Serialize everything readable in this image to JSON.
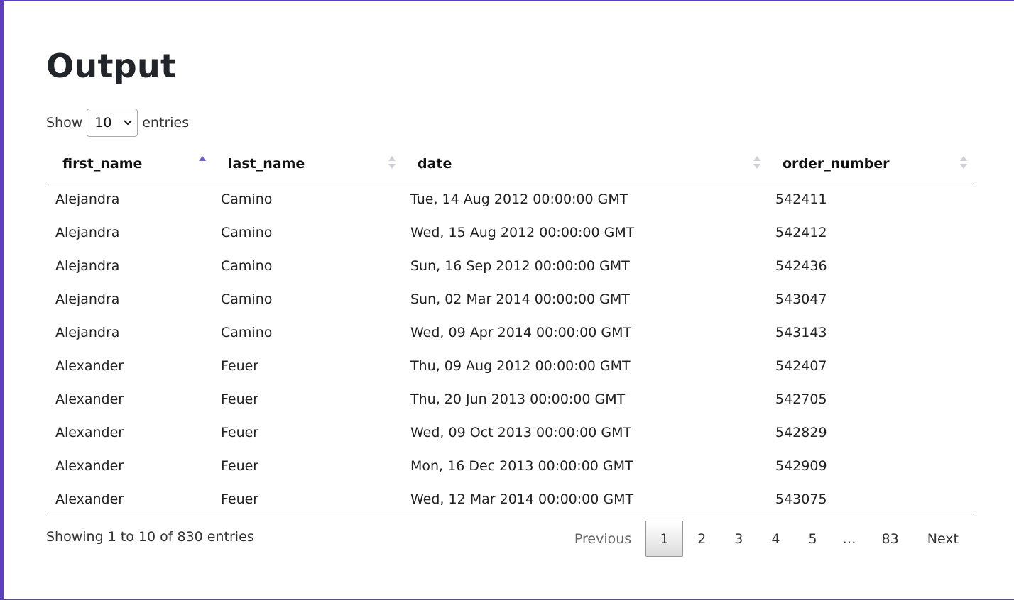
{
  "page": {
    "title": "Output"
  },
  "length": {
    "show_label": "Show",
    "selected": "10",
    "entries_label": "entries"
  },
  "table": {
    "columns": [
      "first_name",
      "last_name",
      "date",
      "order_number"
    ],
    "sorted_column": "first_name",
    "sort_direction": "ascending",
    "rows": [
      [
        "Alejandra",
        "Camino",
        "Tue, 14 Aug 2012 00:00:00 GMT",
        "542411"
      ],
      [
        "Alejandra",
        "Camino",
        "Wed, 15 Aug 2012 00:00:00 GMT",
        "542412"
      ],
      [
        "Alejandra",
        "Camino",
        "Sun, 16 Sep 2012 00:00:00 GMT",
        "542436"
      ],
      [
        "Alejandra",
        "Camino",
        "Sun, 02 Mar 2014 00:00:00 GMT",
        "543047"
      ],
      [
        "Alejandra",
        "Camino",
        "Wed, 09 Apr 2014 00:00:00 GMT",
        "543143"
      ],
      [
        "Alexander",
        "Feuer",
        "Thu, 09 Aug 2012 00:00:00 GMT",
        "542407"
      ],
      [
        "Alexander",
        "Feuer",
        "Thu, 20 Jun 2013 00:00:00 GMT",
        "542705"
      ],
      [
        "Alexander",
        "Feuer",
        "Wed, 09 Oct 2013 00:00:00 GMT",
        "542829"
      ],
      [
        "Alexander",
        "Feuer",
        "Mon, 16 Dec 2013 00:00:00 GMT",
        "542909"
      ],
      [
        "Alexander",
        "Feuer",
        "Wed, 12 Mar 2014 00:00:00 GMT",
        "543075"
      ]
    ]
  },
  "info": {
    "text": "Showing 1 to 10 of 830 entries"
  },
  "pagination": {
    "previous": "Previous",
    "pages": [
      "1",
      "2",
      "3",
      "4",
      "5"
    ],
    "ellipsis": "…",
    "last": "83",
    "next": "Next",
    "current": "1"
  },
  "colors": {
    "accent": "#5b3fbf",
    "sort_active": "#6a64c8"
  }
}
